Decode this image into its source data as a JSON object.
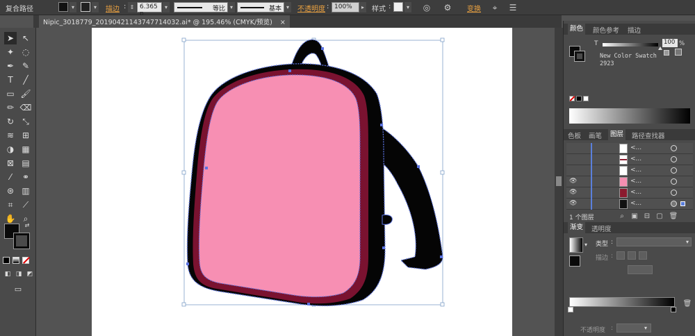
{
  "control_bar": {
    "object_type": "复合路径",
    "stroke_label": "描边",
    "stroke_value": "6.365 p",
    "profile": "等比",
    "brush": "基本",
    "opacity_label": "不透明度",
    "opacity_value": "100%",
    "style_label": "样式",
    "transform_label": "变换"
  },
  "document_tab": {
    "title": "Nipic_3018779_20190421143747714032.ai* @ 195.46% (CMYK/预览)",
    "close": "×"
  },
  "color_panel": {
    "tabs": [
      "颜色",
      "颜色参考",
      "描边"
    ],
    "channel": "T",
    "tint_value": "100",
    "tint_unit": "%",
    "swatch_name": "New Color Swatch",
    "swatch_number": "2923"
  },
  "layers_panel": {
    "tabs": [
      "色板",
      "画笔",
      "图层",
      "路径查找器"
    ],
    "rows": [
      {
        "name": "<...",
        "thumb": "#ffffff",
        "visible": false
      },
      {
        "name": "<...",
        "thumb": "#8b1a2e",
        "visible": false
      },
      {
        "name": "<...",
        "thumb": "#ffffff",
        "visible": false
      },
      {
        "name": "<...",
        "thumb": "#f48fb1",
        "visible": true
      },
      {
        "name": "<...",
        "thumb": "#8b1a2e",
        "visible": true
      },
      {
        "name": "<...",
        "thumb": "#111111",
        "visible": true
      }
    ],
    "footer": "1 个图层"
  },
  "gradient_panel": {
    "tabs": [
      "渐变",
      "透明度"
    ],
    "type_label": "类型",
    "stroke_label": "描边",
    "opacity_label": "不透明度"
  },
  "colors": {
    "bag_pink": "#f78fb3",
    "bag_dark": "#7a1230",
    "bag_black": "#050505",
    "selection": "#5b73e0",
    "orange_label": "#e8a040"
  }
}
